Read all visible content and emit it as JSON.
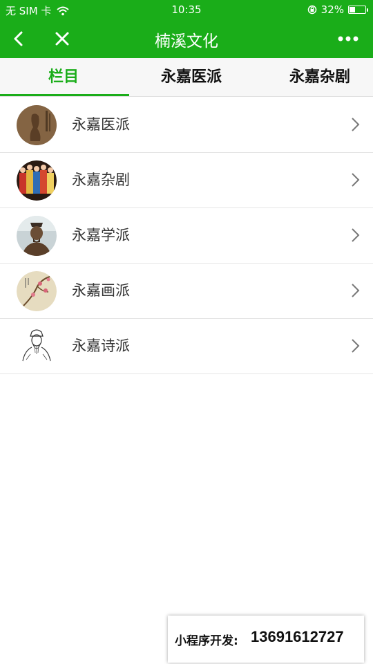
{
  "status_bar": {
    "carrier": "无 SIM 卡",
    "time": "10:35",
    "battery_text": "32%",
    "battery_level": 0.32
  },
  "nav": {
    "title": "楠溪文化"
  },
  "tabs": [
    {
      "label": "栏目",
      "active": true
    },
    {
      "label": "永嘉医派",
      "active": false
    },
    {
      "label": "永嘉杂剧",
      "active": false
    }
  ],
  "list": [
    {
      "label": "永嘉医派",
      "thumbnail": "ancient-painting-figure"
    },
    {
      "label": "永嘉杂剧",
      "thumbnail": "opera-performers"
    },
    {
      "label": "永嘉学派",
      "thumbnail": "bronze-bust"
    },
    {
      "label": "永嘉画派",
      "thumbnail": "flower-bird-painting"
    },
    {
      "label": "永嘉诗派",
      "thumbnail": "scholar-sketch"
    }
  ],
  "watermark": {
    "label": "小程序开发:",
    "phone": "13691612727"
  },
  "colors": {
    "brand_green": "#1aad19"
  }
}
